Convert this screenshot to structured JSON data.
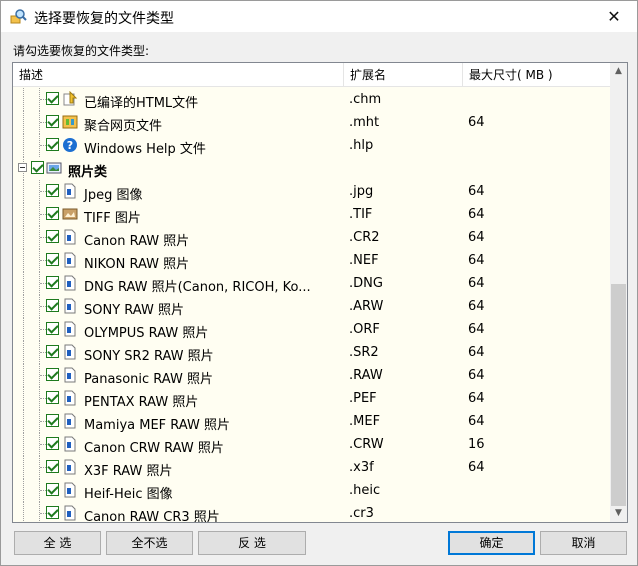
{
  "window": {
    "title": "选择要恢复的文件类型",
    "close_label": "✕"
  },
  "prompt": "请勾选要恢复的文件类型:",
  "columns": {
    "desc": "描述",
    "ext": "扩展名",
    "size": "最大尺寸( MB )"
  },
  "rows": [
    {
      "type": "item",
      "desc": "已编译的HTML文件",
      "ext": ".chm",
      "size": "",
      "icon": "chm-file-icon"
    },
    {
      "type": "item",
      "desc": "聚合网页文件",
      "ext": ".mht",
      "size": "64",
      "icon": "mht-file-icon"
    },
    {
      "type": "item",
      "desc": "Windows Help 文件",
      "ext": ".hlp",
      "size": "",
      "icon": "help-file-icon"
    },
    {
      "type": "group",
      "desc": "照片类",
      "ext": "",
      "size": "",
      "icon": "photo-folder-icon"
    },
    {
      "type": "item",
      "desc": "Jpeg 图像",
      "ext": ".jpg",
      "size": "64",
      "icon": "image-file-icon"
    },
    {
      "type": "item",
      "desc": "TIFF 图片",
      "ext": ".TIF",
      "size": "64",
      "icon": "tiff-file-icon"
    },
    {
      "type": "item",
      "desc": "Canon RAW 照片",
      "ext": ".CR2",
      "size": "64",
      "icon": "image-file-icon"
    },
    {
      "type": "item",
      "desc": "NIKON RAW 照片",
      "ext": ".NEF",
      "size": "64",
      "icon": "image-file-icon"
    },
    {
      "type": "item",
      "desc": "DNG RAW 照片(Canon, RICOH, Ko...",
      "ext": ".DNG",
      "size": "64",
      "icon": "image-file-icon"
    },
    {
      "type": "item",
      "desc": "SONY RAW 照片",
      "ext": ".ARW",
      "size": "64",
      "icon": "image-file-icon"
    },
    {
      "type": "item",
      "desc": "OLYMPUS RAW 照片",
      "ext": ".ORF",
      "size": "64",
      "icon": "image-file-icon"
    },
    {
      "type": "item",
      "desc": "SONY SR2 RAW 照片",
      "ext": ".SR2",
      "size": "64",
      "icon": "image-file-icon"
    },
    {
      "type": "item",
      "desc": "Panasonic RAW 照片",
      "ext": ".RAW",
      "size": "64",
      "icon": "image-file-icon"
    },
    {
      "type": "item",
      "desc": "PENTAX RAW 照片",
      "ext": ".PEF",
      "size": "64",
      "icon": "image-file-icon"
    },
    {
      "type": "item",
      "desc": "Mamiya MEF RAW 照片",
      "ext": ".MEF",
      "size": "64",
      "icon": "image-file-icon"
    },
    {
      "type": "item",
      "desc": "Canon CRW RAW 照片",
      "ext": ".CRW",
      "size": "16",
      "icon": "image-file-icon"
    },
    {
      "type": "item",
      "desc": "X3F RAW 照片",
      "ext": ".x3f",
      "size": "64",
      "icon": "image-file-icon"
    },
    {
      "type": "item",
      "desc": "Heif-Heic 图像",
      "ext": ".heic",
      "size": "",
      "icon": "image-file-icon"
    },
    {
      "type": "item",
      "desc": "Canon RAW CR3 照片",
      "ext": ".cr3",
      "size": "",
      "icon": "image-file-icon"
    }
  ],
  "buttons": {
    "select_all": "全 选",
    "select_none": "全不选",
    "invert": "反 选",
    "ok": "确定",
    "cancel": "取消"
  },
  "colors": {
    "list_bg": "#fffef2",
    "check": "#1e7a1e",
    "accent": "#0078d7"
  }
}
